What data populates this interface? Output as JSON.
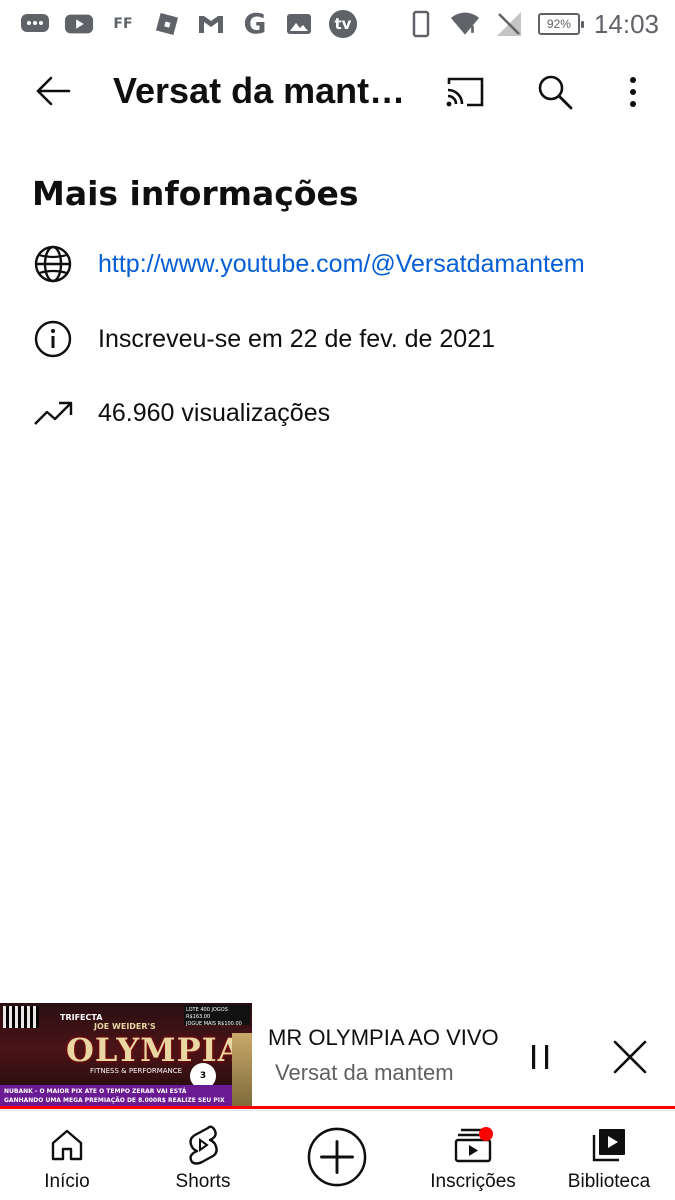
{
  "status_bar": {
    "left_icons": [
      "messages-icon",
      "youtube-icon",
      "ff-icon",
      "roblox-icon",
      "gmail-icon",
      "google-icon",
      "photos-icon",
      "tv-icon"
    ],
    "ff_text": "FF",
    "google_text": "G",
    "tv_text": "tv",
    "battery": "92%",
    "time": "14:03"
  },
  "app_bar": {
    "title": "Versat da mant…"
  },
  "about": {
    "section_title": "Mais informações",
    "link": "http://www.youtube.com/@Versatdamantem",
    "joined": "Inscreveu-se em 22 de fev. de 2021",
    "views": "46.960 visualizações"
  },
  "mini_player": {
    "title": "MR OLYMPIA AO VIVO",
    "channel": "Versat da mantem",
    "thumbnail": {
      "brand": "TRIFECTA",
      "heading": "OLYMPIA",
      "subheading": "JOE WEIDER'S",
      "tagline": "FITNESS & PERFORMANCE",
      "side_lines": [
        "LOTE 400 JOGOS R$163.00",
        "JOGUE MAIS R$100.00"
      ],
      "banner_lines": [
        "NUBANK - O MAIOR PIX ATE O TEMPO ZERAR VAI ESTÁ",
        "GANHANDO UMA MEGA PREMIAÇÃO DE 8.000R$ REALIZE SEU PIX"
      ],
      "badge": "3"
    },
    "progress": 1.0,
    "progress_color": "#ff0000"
  },
  "bottom_nav": {
    "items": [
      {
        "label": "Início",
        "icon": "home-icon"
      },
      {
        "label": "Shorts",
        "icon": "shorts-icon"
      },
      {
        "label": "",
        "icon": "create-icon"
      },
      {
        "label": "Inscrições",
        "icon": "subscriptions-icon",
        "badge_color": "#ff0000"
      },
      {
        "label": "Biblioteca",
        "icon": "library-icon"
      }
    ]
  },
  "colors": {
    "link": "#065fd4",
    "text": "#0f0f0f",
    "secondary": "#606060",
    "accent": "#ff0000"
  }
}
